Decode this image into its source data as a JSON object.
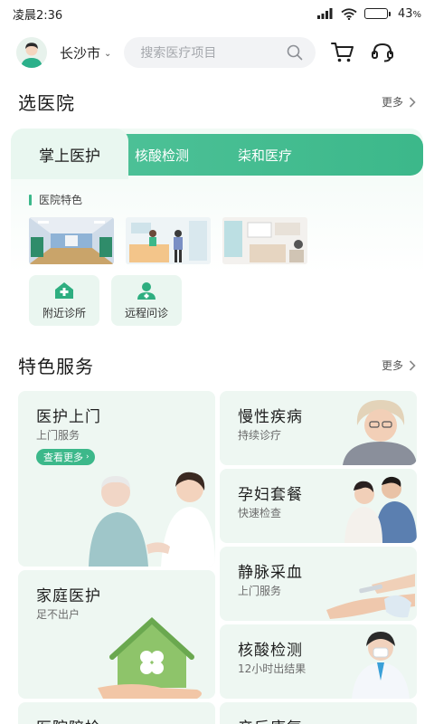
{
  "status_bar": {
    "time": "凌晨2:36",
    "battery": "43",
    "battery_level": 0.43,
    "signal_icon": "signal-icon",
    "wifi_icon": "wifi-icon",
    "battery_icon": "battery-icon"
  },
  "header": {
    "city": "长沙市",
    "search_placeholder": "搜索医疗项目",
    "icons": [
      "avatar",
      "search-icon",
      "cart-icon",
      "headset-icon"
    ]
  },
  "hospital": {
    "title": "选医院",
    "more": "更多",
    "tabs": [
      {
        "label": "掌上医护",
        "active": true
      },
      {
        "label": "核酸检测",
        "active": false
      },
      {
        "label": "柒和医疗",
        "active": false
      }
    ],
    "feature_label": "医院特色",
    "services": [
      {
        "label": "附近诊所",
        "icon": "clinic-plus-icon"
      },
      {
        "label": "远程问诊",
        "icon": "doctor-icon"
      }
    ]
  },
  "featured": {
    "title": "特色服务",
    "more": "更多",
    "cards": [
      {
        "title": "医护上门",
        "subtitle": "上门服务",
        "button": "查看更多"
      },
      {
        "title": "慢性疾病",
        "subtitle": "持续诊疗"
      },
      {
        "title": "孕妇套餐",
        "subtitle": "快速检查"
      },
      {
        "title": "静脉采血",
        "subtitle": "上门服务"
      },
      {
        "title": "家庭医护",
        "subtitle": "足不出户"
      },
      {
        "title": "核酸检测",
        "subtitle": "12小时出结果"
      },
      {
        "title": "医院陪检",
        "subtitle": ""
      },
      {
        "title": "产后康复",
        "subtitle": ""
      }
    ]
  },
  "colors": {
    "accent": "#3cb88a",
    "tab_gradient_start": "#52c49b",
    "card_bg": "#eef7f2"
  }
}
